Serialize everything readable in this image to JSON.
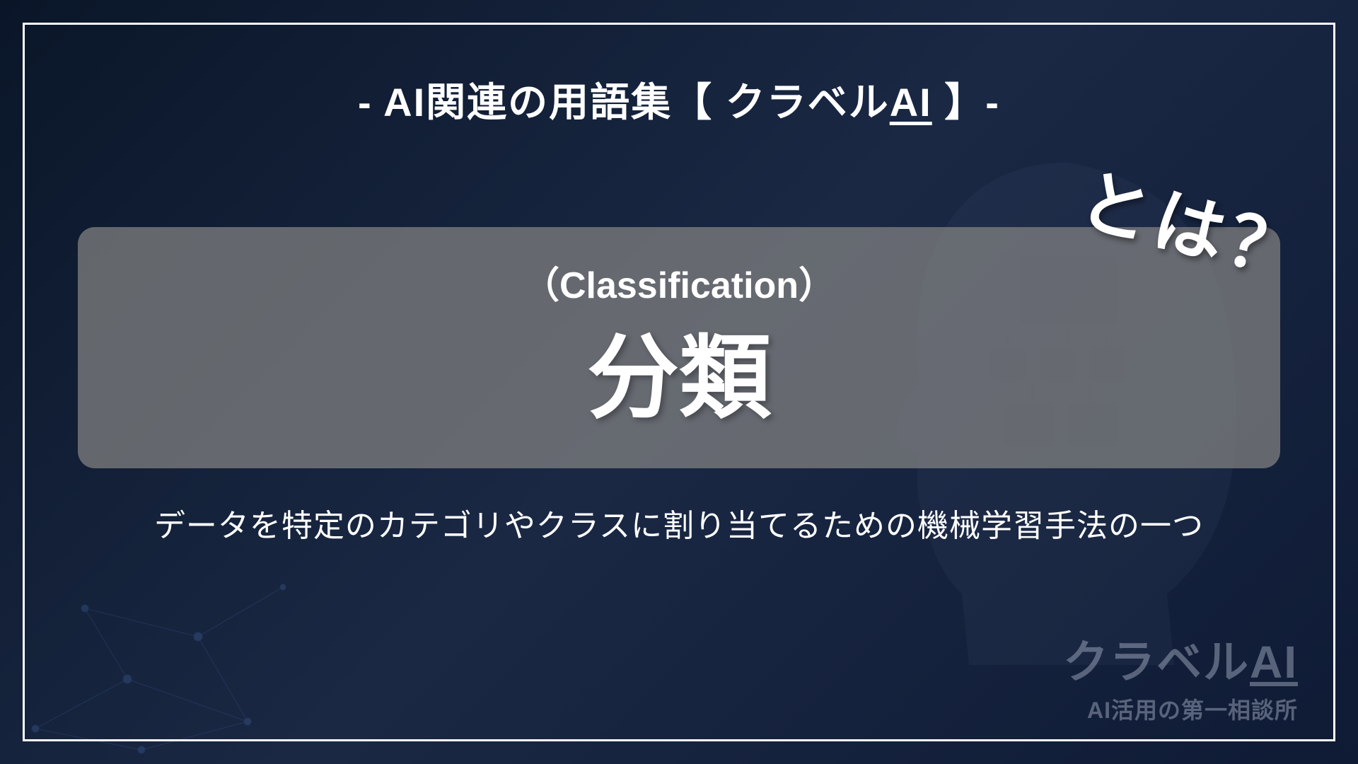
{
  "header": {
    "prefix": "- AI関連の用語集【 クラベル",
    "underlined": "AI",
    "suffix": " 】-"
  },
  "term": {
    "english": "（Classification）",
    "japanese": "分類",
    "toha": "とは？"
  },
  "description": "データを特定のカテゴリやクラスに割り当てるための機械学習手法の一つ",
  "brand": {
    "name_prefix": "クラベル",
    "name_ai": "AI",
    "tagline": "AI活用の第一相談所"
  }
}
